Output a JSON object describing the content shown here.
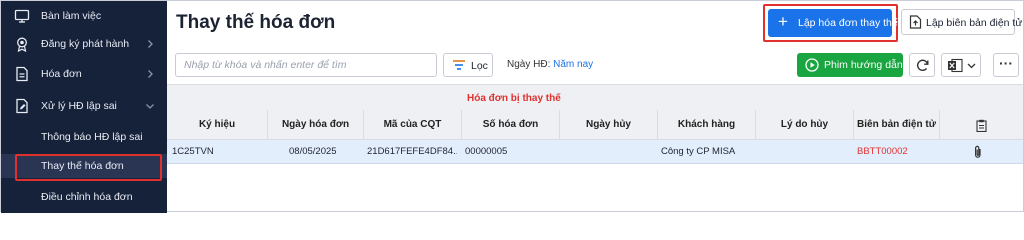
{
  "sidebar": {
    "items": [
      {
        "label": "Bàn làm việc"
      },
      {
        "label": "Đăng ký phát hành"
      },
      {
        "label": "Hóa đơn"
      },
      {
        "label": "Xử lý HĐ lập sai"
      }
    ],
    "subitems": [
      {
        "label": "Thông báo HĐ lập sai"
      },
      {
        "label": "Thay thế hóa đơn"
      },
      {
        "label": "Điều chỉnh hóa đơn"
      }
    ]
  },
  "main": {
    "title": "Thay thế hóa đơn",
    "create_button": "Lập hóa đơn thay thế",
    "report_button": "Lập biên bản điện tử",
    "search_placeholder": "Nhập từ khóa và nhấn enter để tìm",
    "filter_button": "Lọc",
    "date_label": "Ngày HĐ:",
    "date_value": "Năm nay",
    "guide_button": "Phim hướng dẫn"
  },
  "table": {
    "group_title": "Hóa đơn bị thay thế",
    "columns": [
      "Ký hiệu",
      "Ngày hóa đơn",
      "Mã của CQT",
      "Số hóa đơn",
      "Ngày hủy",
      "Khách hàng",
      "Lý do hủy",
      "Biên bản điện tử"
    ],
    "rows": [
      {
        "ky_hieu": "1C25TVN",
        "ngay_hoa_don": "08/05/2025",
        "ma_cqt": "21D617FEFE4DF84...",
        "so_hoa_don": "00000005",
        "ngay_huy": "",
        "khach_hang": "Công ty CP MISA",
        "ly_do_huy": "",
        "bien_ban": "BBTT00002"
      }
    ]
  },
  "colors": {
    "sidebar_bg": "#16213a",
    "primary": "#1a73e8",
    "green": "#19a540",
    "highlight": "#e0312f"
  },
  "icons": [
    "monitor-icon",
    "badge-icon",
    "document-icon",
    "edit-document-icon",
    "chevron-right-icon",
    "chevron-down-icon",
    "plus-icon",
    "upload-document-icon",
    "filter-icon",
    "play-icon",
    "refresh-icon",
    "excel-icon",
    "more-icon",
    "clipboard-icon",
    "paperclip-icon"
  ]
}
